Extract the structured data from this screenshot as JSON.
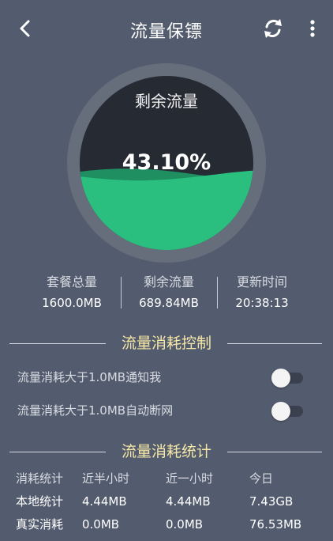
{
  "header": {
    "title": "流量保镖",
    "back_icon": "back-arrow-icon",
    "refresh_icon": "refresh-icon",
    "more_icon": "more-vertical-icon"
  },
  "gauge": {
    "label": "剩余流量",
    "percent_text": "43.10%",
    "fill_fraction": 0.431,
    "colors": {
      "ring": "#666d7b",
      "empty": "#262a33",
      "fill": "#2bbf7f",
      "fill_dark": "#1f8f61"
    }
  },
  "stats": [
    {
      "label": "套餐总量",
      "value": "1600.0MB"
    },
    {
      "label": "剩余流量",
      "value": "689.84MB"
    },
    {
      "label": "更新时间",
      "value": "20:38:13"
    }
  ],
  "control": {
    "title": "流量消耗控制",
    "toggles": [
      {
        "label": "流量消耗大于1.0MB通知我",
        "on": false
      },
      {
        "label": "流量消耗大于1.0MB自动断网",
        "on": false
      }
    ]
  },
  "statistics": {
    "title": "流量消耗统计",
    "headers": [
      "消耗统计",
      "近半小时",
      "近一小时",
      "今日"
    ],
    "rows": [
      [
        "本地统计",
        "4.44MB",
        "4.44MB",
        "7.43GB"
      ],
      [
        "真实消耗",
        "0.0MB",
        "0.0MB",
        "76.53MB"
      ]
    ]
  },
  "colors": {
    "background": "#535c6e",
    "section_title": "#f6e7a6"
  }
}
